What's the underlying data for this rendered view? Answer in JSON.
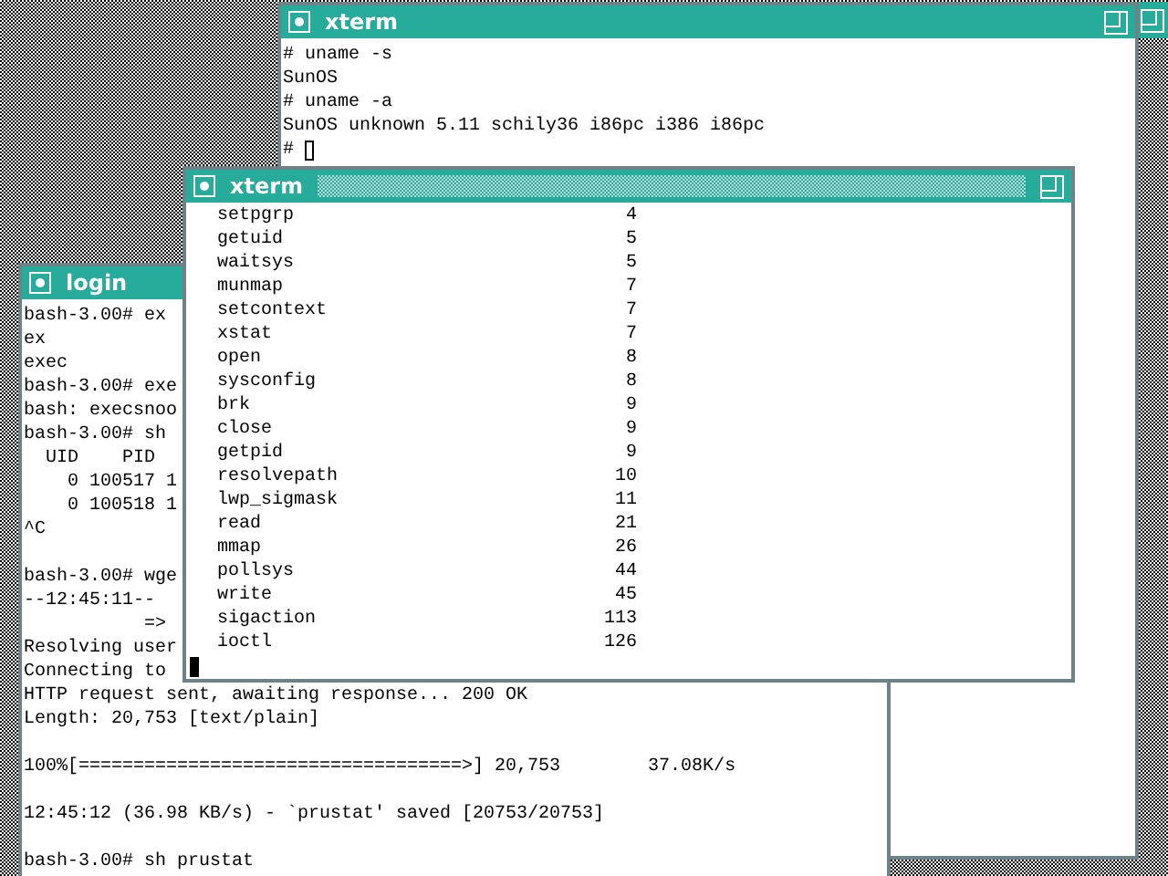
{
  "windows": [
    {
      "kind": "shell",
      "title": "xterm",
      "focused": false,
      "blocks": [
        [
          "# uname -s",
          "SunOS",
          "# uname -a",
          "SunOS unknown 5.11 schily36 i86pc i386 i86pc",
          "# "
        ]
      ]
    },
    {
      "kind": "shell",
      "title": "login",
      "blocks": [
        [
          "bash-3.00# ex",
          "ex",
          "exec",
          "bash-3.00# exe",
          "bash: execsnoo",
          "bash-3.00# sh",
          "  UID    PID",
          "    0 100517 1",
          "    0 100518 1",
          "^C"
        ],
        [
          "bash-3.00# wge",
          "--12:45:11--",
          "           =>",
          "Resolving user",
          "Connecting to",
          "HTTP request sent, awaiting response... 200 OK",
          "Length: 20,753 [text/plain]"
        ],
        [
          "100%[===================================>] 20,753        37.08K/s"
        ],
        [
          "12:45:12 (36.98 KB/s) - `prustat' saved [20753/20753]"
        ],
        [
          "bash-3.00# sh prustat"
        ]
      ]
    },
    {
      "kind": "table",
      "title": "xterm",
      "focused": true,
      "rows": [
        {
          "name": "setpgrp",
          "count": "4"
        },
        {
          "name": "getuid",
          "count": "5"
        },
        {
          "name": "waitsys",
          "count": "5"
        },
        {
          "name": "munmap",
          "count": "7"
        },
        {
          "name": "setcontext",
          "count": "7"
        },
        {
          "name": "xstat",
          "count": "7"
        },
        {
          "name": "open",
          "count": "8"
        },
        {
          "name": "sysconfig",
          "count": "8"
        },
        {
          "name": "brk",
          "count": "9"
        },
        {
          "name": "close",
          "count": "9"
        },
        {
          "name": "getpid",
          "count": "9"
        },
        {
          "name": "resolvepath",
          "count": "10"
        },
        {
          "name": "lwp_sigmask",
          "count": "11"
        },
        {
          "name": "read",
          "count": "21"
        },
        {
          "name": "mmap",
          "count": "26"
        },
        {
          "name": "pollsys",
          "count": "44"
        },
        {
          "name": "write",
          "count": "45"
        },
        {
          "name": "sigaction",
          "count": "113"
        },
        {
          "name": "ioctl",
          "count": "126"
        }
      ]
    }
  ]
}
